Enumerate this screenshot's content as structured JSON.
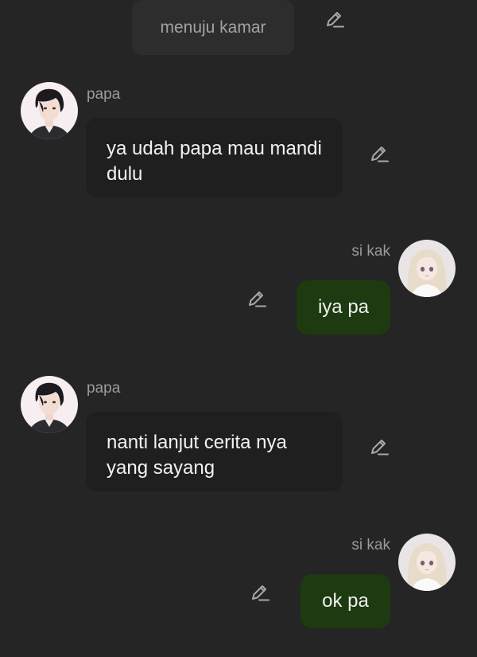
{
  "narration": {
    "text": "menuju kamar",
    "edit_icon": "pencil-edit-icon"
  },
  "messages": [
    {
      "sender": "papa",
      "side": "left",
      "text": "ya udah papa mau mandi dulu",
      "avatar": "man-dark-hair-avatar",
      "edit_icon": "pencil-edit-icon"
    },
    {
      "sender": "si kak",
      "side": "right",
      "text": "iya pa",
      "avatar": "girl-blonde-hair-avatar",
      "edit_icon": "pencil-edit-icon"
    },
    {
      "sender": "papa",
      "side": "left",
      "text": "nanti lanjut cerita nya yang sayang",
      "avatar": "man-dark-hair-avatar",
      "edit_icon": "pencil-edit-icon"
    },
    {
      "sender": "si kak",
      "side": "right",
      "text": "ok pa",
      "avatar": "girl-blonde-hair-avatar",
      "edit_icon": "pencil-edit-icon"
    }
  ],
  "colors": {
    "background": "#252525",
    "incoming_bubble": "#1f1f1f",
    "outgoing_bubble": "#1d3a10",
    "narration_bubble": "#2d2d2d",
    "sender_name": "#9b9b9b"
  }
}
